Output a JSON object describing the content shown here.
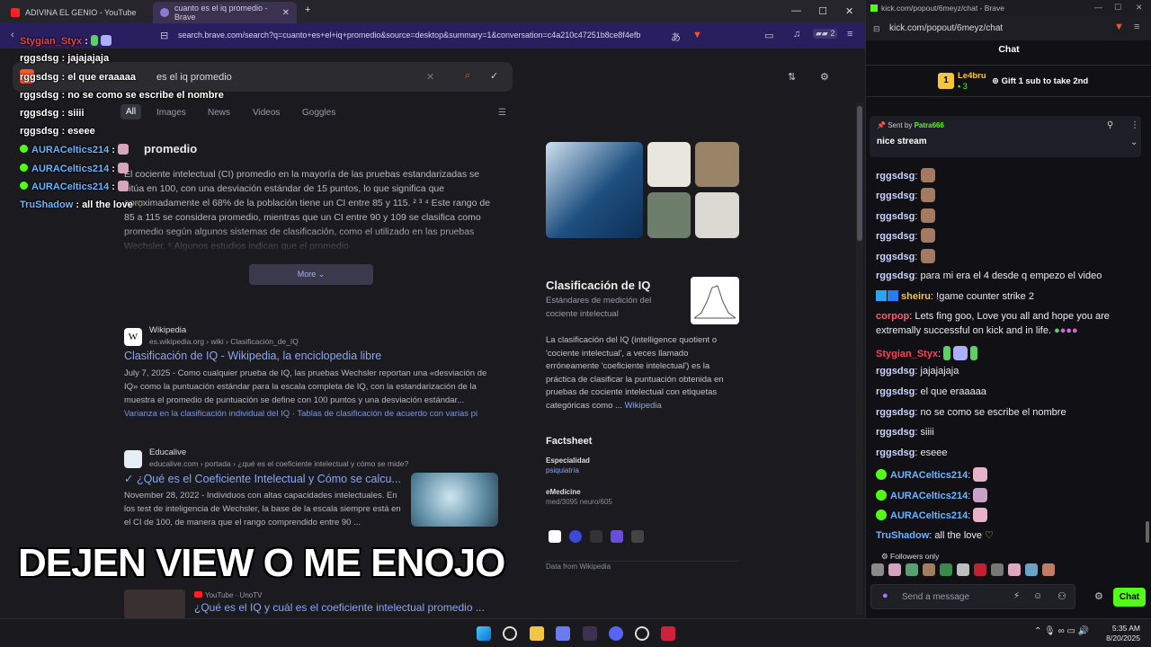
{
  "left_browser": {
    "tabs": [
      {
        "label": "ADIVINA EL GENIO - YouTube"
      },
      {
        "label": "cuanto es el iq promedio - Brave"
      }
    ],
    "url": "search.brave.com/search?q=cuanto+es+el+iq+promedio&source=desktop&summary=1&conversation=c4a210c47251b8ce8f4efb",
    "ext_badge": "2",
    "search_query": "es el iq promedio",
    "search_tabs": [
      "All",
      "Images",
      "News",
      "Videos",
      "Goggles"
    ],
    "summary_title": "promedio",
    "summary_text": "El cociente intelectual (CI) promedio en la mayoría de las pruebas estandarizadas se sitúa en 100, con una desviación estándar de 15 puntos, lo que significa que aproximadamente el 68% de la población tiene un CI entre 85 y 115. ² ³ ⁴ Este rango de 85 a 115 se considera promedio, mientras que un CI entre 90 y 109 se clasifica como promedio según algunos sistemas de clasificación, como el utilizado en las pruebas Wechsler. ⁵ Algunos estudios indican que el promedio",
    "more_label": "More ⌄",
    "results": [
      {
        "source": "Wikipedia",
        "breadcrumb": "es.wikipedia.org › wiki › Clasificación_de_IQ",
        "title": "Clasificación de IQ - Wikipedia, la enciclopedia libre",
        "snippet": "July 7, 2025 - Como cualquier prueba de IQ, las pruebas Wechsler reportan una «desviación de IQ» como la puntuación estándar para la escala completa de IQ, con la estandarización de la muestra el promedio de puntuación se define con 100 puntos y una desviación estándar...",
        "sublinks": "Varianza en la clasificación individual del IQ · Tablas de clasificación de acuerdo con varias pi"
      },
      {
        "source": "Educalive",
        "breadcrumb": "educalive.com › portada › ¿qué es el coeficiente intelectual y cómo se mide?",
        "title": "✓ ¿Qué es el Coeficiente Intelectual y Cómo se calcu...",
        "snippet": "November 28, 2022 - Individuos con altas capacidades intelectuales. En los test de inteligencia de Wechsler, la base de la escala siempre está en el CI de 100, de manera que el rango comprendido entre 90 ..."
      },
      {
        "source": "YouTube",
        "channel": "UnoTV",
        "title": "¿Qué es el IQ y cuál es el coeficiente intelectual promedio ..."
      }
    ],
    "knowledge_panel": {
      "title": "Clasificación de IQ",
      "subtitle": "Estándares de medición del cociente intelectual",
      "description": "La clasificación del IQ (intelligence quotient o 'cociente intelectual', a veces llamado erróneamente 'coeficiente intelectual') es la práctica de clasificar la puntuación obtenida en pruebas de cociente intelectual con etiquetas categóricas como ...",
      "source_link": "Wikipedia",
      "factsheet_label": "Factsheet",
      "facts": [
        {
          "label": "Especialidad",
          "value": "psiquiatría"
        },
        {
          "label": "eMedicine",
          "value": "med/3095 neuro/605"
        }
      ],
      "data_from": "Data from Wikipedia"
    }
  },
  "overlay": {
    "caption": "DEJEN VIEW O ME ENOJO",
    "chat_lines": [
      {
        "user": "Stygian_Styx",
        "msg": "",
        "color": "#e0454f"
      },
      {
        "user": "rggsdsg",
        "msg": "jajajajaja"
      },
      {
        "user": "rggsdsg",
        "msg": "el que eraaaaa"
      },
      {
        "user": "rggsdsg",
        "msg": "no se como se escribe el nombre"
      },
      {
        "user": "rggsdsg",
        "msg": "siiii"
      },
      {
        "user": "rggsdsg",
        "msg": "eseee"
      },
      {
        "user": "AURACeltics214",
        "msg": ""
      },
      {
        "user": "AURACeltics214",
        "msg": ""
      },
      {
        "user": "AURACeltics214",
        "msg": ""
      },
      {
        "user": "TruShadow",
        "msg": "all the love"
      }
    ]
  },
  "kick": {
    "window_url": "kick.com/popout/6meyz/chat - Brave",
    "addr": "kick.com/popout/6meyz/chat",
    "chat_title": "Chat",
    "gifter": {
      "name": "Le4bru",
      "count": "3",
      "rank": "1"
    },
    "gift_cta": "Gift 1 sub to take 2nd",
    "pinned": {
      "sent_by_label": "Sent by",
      "sender": "Patra666",
      "text": "nice stream"
    },
    "messages": [
      {
        "user": "rggsdsg",
        "msg": ""
      },
      {
        "user": "rggsdsg",
        "msg": ""
      },
      {
        "user": "rggsdsg",
        "msg": ""
      },
      {
        "user": "rggsdsg",
        "msg": ""
      },
      {
        "user": "rggsdsg",
        "msg": ""
      },
      {
        "user": "rggsdsg",
        "msg": "para mi era el 4 desde q empezo el video"
      },
      {
        "user": "sheiru",
        "msg": "!game counter strike 2"
      },
      {
        "user": "corpop",
        "msg": "Lets fing goo, Love you all and hope you are"
      },
      {
        "user": "",
        "msg": "extremally successful on kick and in life."
      },
      {
        "user": "Stygian_Styx",
        "msg": ""
      },
      {
        "user": "rggsdsg",
        "msg": "jajajajaja"
      },
      {
        "user": "rggsdsg",
        "msg": "el que eraaaaa"
      },
      {
        "user": "rggsdsg",
        "msg": "no se como se escribe el nombre"
      },
      {
        "user": "rggsdsg",
        "msg": "siiii"
      },
      {
        "user": "rggsdsg",
        "msg": "eseee"
      },
      {
        "user": "AURACeltics214",
        "msg": ""
      },
      {
        "user": "AURACeltics214",
        "msg": ""
      },
      {
        "user": "AURACeltics214",
        "msg": ""
      },
      {
        "user": "TruShadow",
        "msg": "all the love"
      }
    ],
    "followers_only": "Followers only",
    "send_placeholder": "Send a message",
    "chat_button": "Chat"
  },
  "taskbar": {
    "time": "5:35 AM",
    "date": "8/20/2025"
  }
}
